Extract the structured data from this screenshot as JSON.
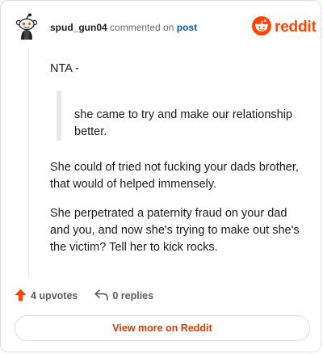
{
  "header": {
    "username": "spud_gun04",
    "verb": "commented on",
    "target_link": "post",
    "logo_text": "reddit",
    "avatar_icon": "snoo-avatar-icon",
    "logo_icon": "reddit-logo-icon",
    "brand_color": "#ff4500"
  },
  "comment": {
    "p1": "NTA -",
    "quote": "she came to try and make our relationship better.",
    "p3": "She could of tried not fucking your dads brother, that would of helped immensely.",
    "p4": "She perpetrated a paternity fraud on your dad and you, and now she's trying to make out she's the victim? Tell her to kick rocks."
  },
  "actions": {
    "upvotes_label": "4 upvotes",
    "replies_label": "0 replies",
    "upvote_icon": "upvote-arrow-icon",
    "reply_icon": "reply-arrow-icon",
    "upvote_color": "#ff4500"
  },
  "footer": {
    "view_more_label": "View more on Reddit"
  }
}
